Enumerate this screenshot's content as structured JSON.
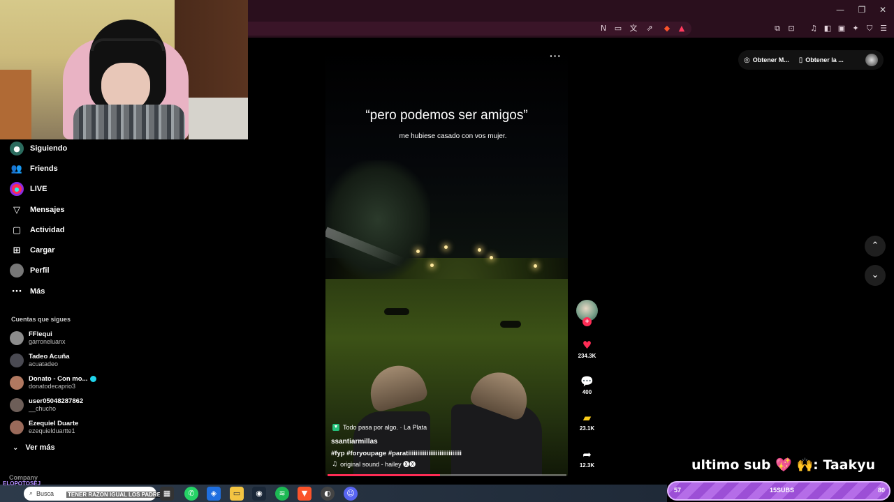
{
  "browser": {
    "window_controls": {
      "minimize": "—",
      "restore": "❐",
      "close": "✕"
    },
    "toolbar_icons": [
      "N",
      "▭",
      "文",
      "⇗",
      "◆",
      "▲",
      "⧉",
      "⊡",
      "♫",
      "◧",
      "▣",
      "✦",
      "⛉",
      "☰"
    ]
  },
  "sidebar": {
    "nav": [
      {
        "label": "Siguiendo",
        "icon": "following-icon"
      },
      {
        "label": "Friends",
        "icon": "friends-icon"
      },
      {
        "label": "LIVE",
        "icon": "live-icon"
      },
      {
        "label": "Mensajes",
        "icon": "messages-icon"
      },
      {
        "label": "Actividad",
        "icon": "activity-icon"
      },
      {
        "label": "Cargar",
        "icon": "upload-icon"
      },
      {
        "label": "Perfil",
        "icon": "profile-icon"
      },
      {
        "label": "Más",
        "icon": "more-icon"
      }
    ],
    "following_title": "Cuentas que sigues",
    "following": [
      {
        "name": "FFlequi",
        "user": "garroneluanx",
        "color": "#8c8c8c"
      },
      {
        "name": "Tadeo Acuña",
        "user": "acuatadeo",
        "color": "#4a4a52"
      },
      {
        "name": "Donato - Con mo...",
        "user": "donatodecaprio3",
        "color": "#b07860",
        "verified": true
      },
      {
        "name": "user05048287862",
        "user": "__chucho",
        "color": "#6d5e58"
      },
      {
        "name": "Ezequiel Duarte",
        "user": "ezequielduartte1",
        "color": "#9a6a5a"
      }
    ],
    "see_more": "Ver más"
  },
  "video": {
    "caption_quote": "“pero podemos ser amigos”",
    "caption_sub": "me hubiese casado con vos mujer.",
    "more": "···",
    "location": "Todo pasa por algo. · La Plata",
    "author": "ssantiarmillas",
    "tags": "#fyp  #foryoupage  #paratiiiiiiiiiiiiiiiiiiiiiiiiiiiii",
    "sound": "original sound - hailey 🅧🅧",
    "progress": 0.47
  },
  "actions": {
    "likes": "234.3K",
    "comments": "400",
    "saves": "23.1K",
    "shares": "12.3K"
  },
  "top_actions": {
    "get_app": "Obtener M...",
    "get_desktop": "Obtener la ..."
  },
  "overlay": {
    "sub_text": "ultimo sub",
    "sub_name": ": Taakyu",
    "bar_left": "57",
    "bar_center": "15SUBS",
    "bar_right": "80",
    "company": "Company",
    "chat_handle": "ELOPOTOSEJ"
  },
  "taskbar": {
    "search_placeholder": "Busca",
    "ticker": "TENER RAZON IGUAL LOS PADRES"
  },
  "colors": {
    "accent": "#fe2c55",
    "browser_bar": "#2a0f1d",
    "sub_bar": "#b56de8"
  }
}
